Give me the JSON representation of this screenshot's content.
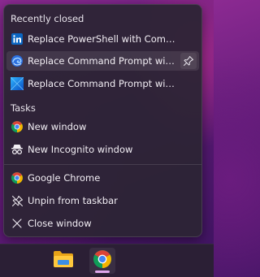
{
  "jumplist": {
    "recent": {
      "header": "Recently closed",
      "items": [
        {
          "label": "Replace PowerShell with Comma...",
          "icon": "linkedin-icon"
        },
        {
          "label": "Replace Command Prompt with ...",
          "icon": "edge-swirl-icon",
          "pin_icon": "pin-icon"
        },
        {
          "label": "Replace Command Prompt with ...",
          "icon": "windows-logo-icon"
        }
      ]
    },
    "tasks": {
      "header": "Tasks",
      "items": [
        {
          "label": "New window",
          "icon": "chrome-icon"
        },
        {
          "label": "New Incognito window",
          "icon": "incognito-icon"
        }
      ]
    },
    "app": {
      "items": [
        {
          "label": "Google Chrome",
          "icon": "chrome-icon"
        },
        {
          "label": "Unpin from taskbar",
          "icon": "unpin-icon"
        },
        {
          "label": "Close window",
          "icon": "close-icon"
        }
      ]
    }
  },
  "taskbar": {
    "apps": [
      {
        "name": "File Explorer",
        "icon": "folder-icon"
      },
      {
        "name": "Google Chrome",
        "icon": "chrome-icon",
        "active": true
      }
    ]
  },
  "colors": {
    "accent": "#e0a8ee",
    "linkedin": "#0a66c2",
    "chrome_red": "#db4437",
    "chrome_yellow": "#f4b400",
    "chrome_green": "#0f9d58",
    "chrome_blue": "#4285f4"
  }
}
